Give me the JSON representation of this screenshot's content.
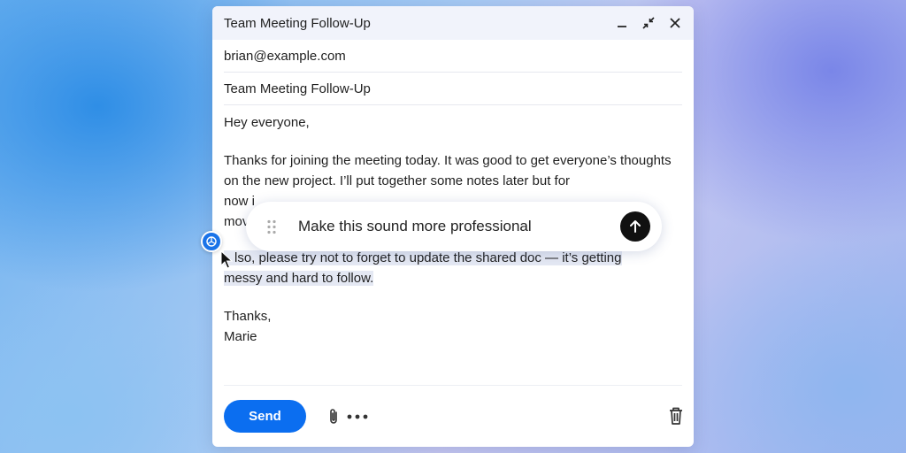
{
  "window": {
    "title": "Team Meeting Follow-Up",
    "controls": [
      "minimize-icon",
      "collapse-icon",
      "close-icon"
    ]
  },
  "compose": {
    "to": "brian@example.com",
    "subject": "Team Meeting Follow-Up",
    "body": {
      "greeting": "Hey everyone,",
      "para1_visible": "Thanks for joining the meeting today. It was good to get everyone’s thoughts on the new project. I’ll put together some notes later but for",
      "para1_partial_1": "now i",
      "para1_partial_2": "mov",
      "para2_line1": "lso, please try not to forget to update the shared doc — it’s getting",
      "para2_line2": "messy and hard to follow.",
      "signoff": "Thanks,",
      "signature": "Marie"
    }
  },
  "footer": {
    "send_label": "Send",
    "icons": [
      "paperclip-icon",
      "more-dots-icon",
      "trash-icon"
    ]
  },
  "prompt": {
    "value": "Make this sound more professional",
    "icons": [
      "drag-grip-icon",
      "arrow-up-icon"
    ]
  },
  "assistant_badge": {
    "icon": "openai-logo-icon"
  },
  "colors": {
    "send_button": "#0b6ef0",
    "submit_button": "#111111",
    "badge": "#1a73e8",
    "highlight": "#e4e8f3"
  }
}
